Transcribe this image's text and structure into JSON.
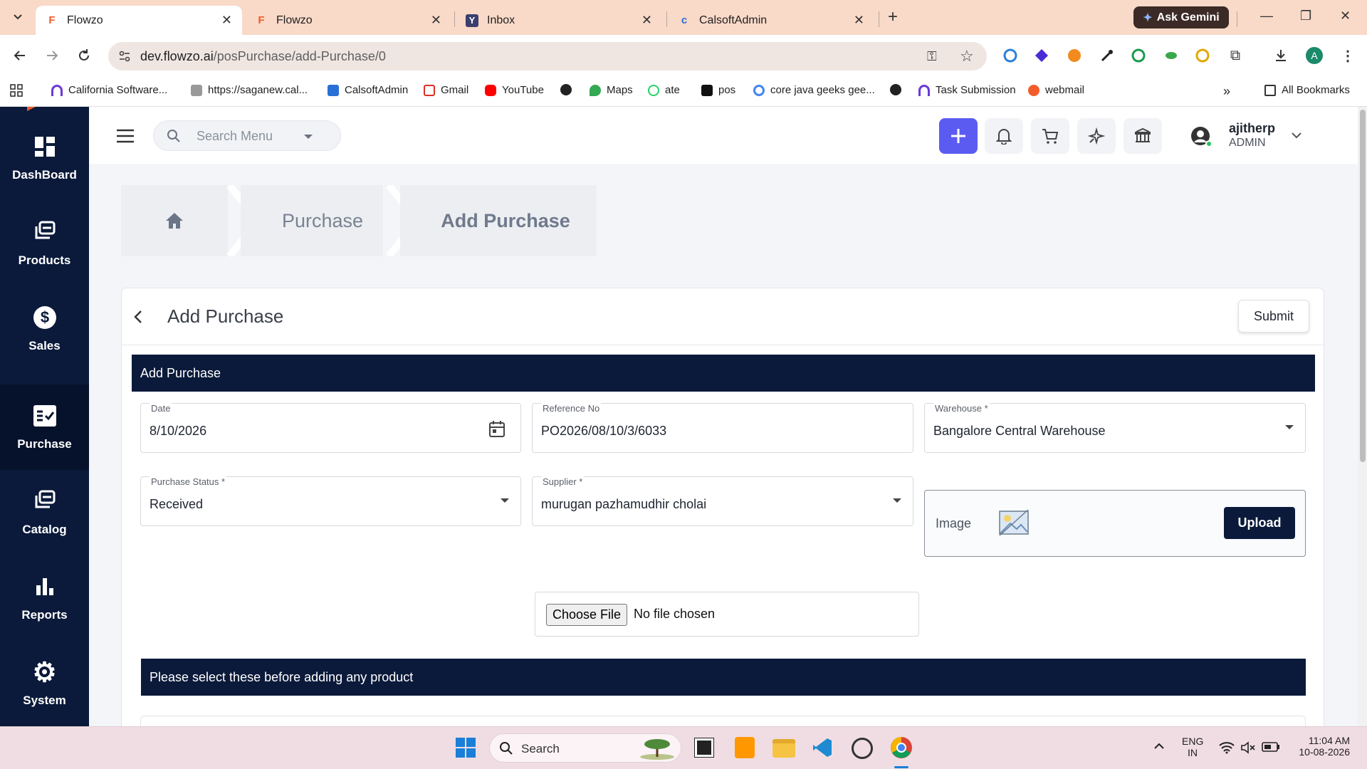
{
  "browser": {
    "tabs": [
      {
        "title": "Flowzo",
        "active": true
      },
      {
        "title": "Flowzo",
        "active": false
      },
      {
        "title": "Inbox",
        "active": false
      },
      {
        "title": "CalsoftAdmin",
        "active": false
      }
    ],
    "gemini_label": "Ask Gemini",
    "url_host": "dev.flowzo.ai",
    "url_path": "/posPurchase/add-Purchase/0",
    "profile_initial": "A",
    "bookmarks": [
      "California Software...",
      "https://saganew.cal...",
      "CalsoftAdmin",
      "Gmail",
      "YouTube",
      "Maps",
      "ate",
      "pos",
      "core java geeks gee...",
      "Task Submission",
      "webmail"
    ],
    "all_bookmarks": "All Bookmarks"
  },
  "sidebar": {
    "items": [
      {
        "label": "DashBoard",
        "icon": "dashboard-icon"
      },
      {
        "label": "Products",
        "icon": "products-icon"
      },
      {
        "label": "Sales",
        "icon": "dollar-icon"
      },
      {
        "label": "Purchase",
        "icon": "purchase-icon",
        "active": true
      },
      {
        "label": "Catalog",
        "icon": "catalog-icon"
      },
      {
        "label": "Reports",
        "icon": "bar-chart-icon"
      },
      {
        "label": "System",
        "icon": "gear-icon"
      }
    ]
  },
  "header": {
    "search_placeholder": "Search Menu",
    "user_name": "ajitherp",
    "user_role": "ADMIN"
  },
  "breadcrumb": {
    "items": [
      "Purchase",
      "Add Purchase"
    ]
  },
  "page": {
    "title": "Add Purchase",
    "submit_label": "Submit",
    "section_title": "Add Purchase",
    "fields": {
      "date": {
        "label": "Date",
        "value": "8/10/2026"
      },
      "reference": {
        "label": "Reference No",
        "value": "PO2026/08/10/3/6033"
      },
      "warehouse": {
        "label": "Warehouse *",
        "value": "Bangalore Central Warehouse"
      },
      "status": {
        "label": "Purchase Status *",
        "value": "Received"
      },
      "supplier": {
        "label": "Supplier *",
        "value": "murugan pazhamudhir cholai"
      }
    },
    "image_label": "Image",
    "upload_label": "Upload",
    "choose_file_label": "Choose File",
    "no_file_text": "No file chosen",
    "notice": "Please select these before adding any product"
  },
  "taskbar": {
    "search_label": "Search",
    "lang_top": "ENG",
    "lang_bottom": "IN",
    "time": "11:04 AM",
    "date": "10-08-2026"
  },
  "colors": {
    "navy": "#0b1a3a",
    "accent": "#5b5bf2",
    "tab_bar": "#f9d9c8"
  }
}
